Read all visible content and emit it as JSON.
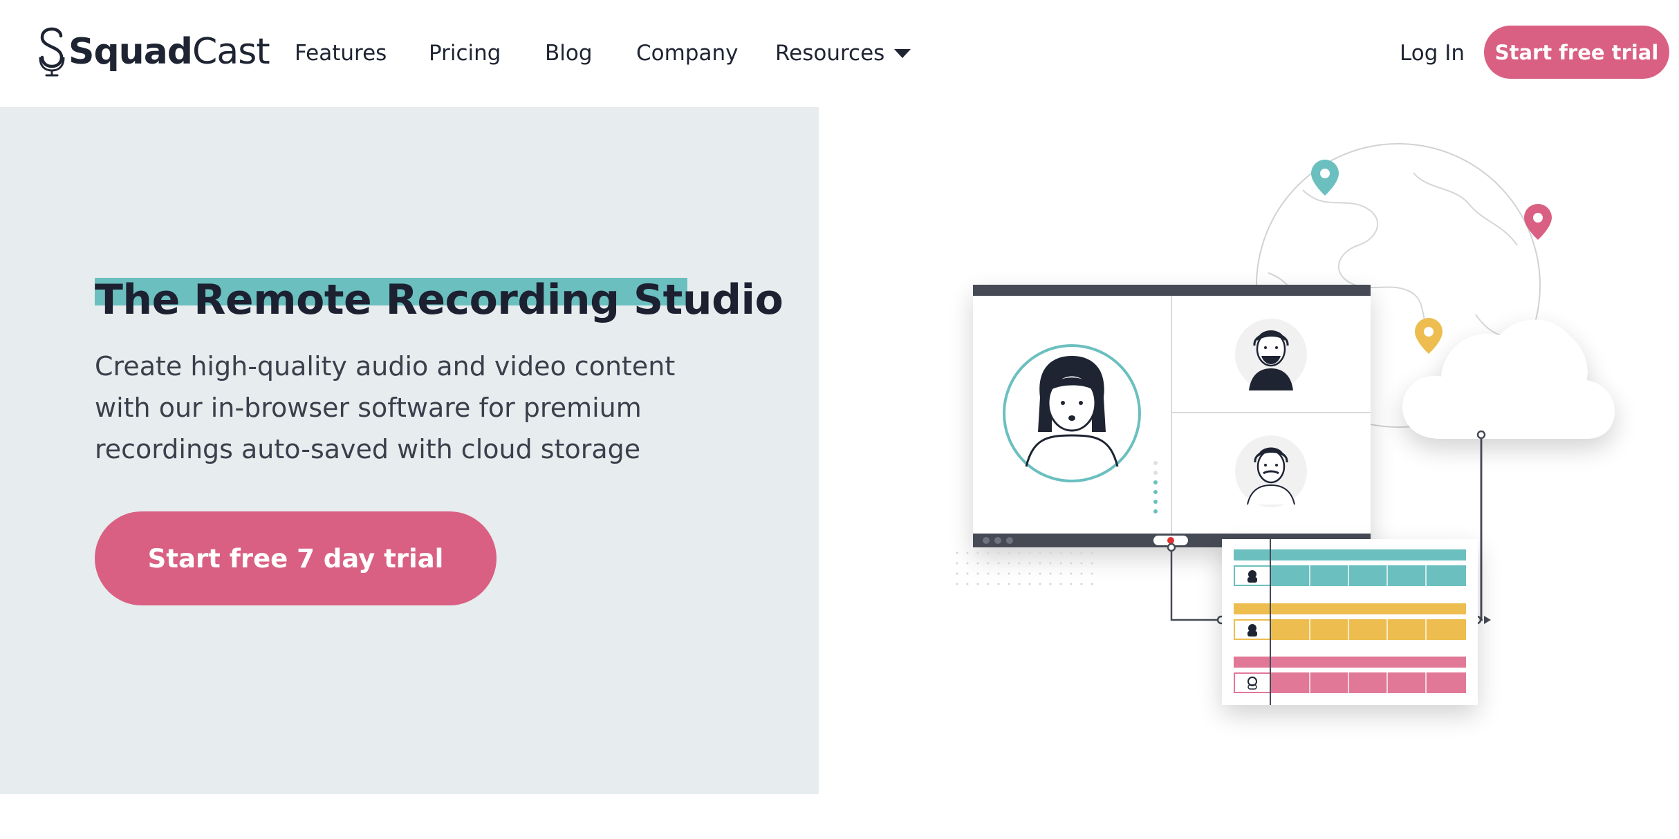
{
  "brand": {
    "name_bold": "Squad",
    "name_light": "Cast",
    "logo_icon": "microphone-s-logo-icon",
    "accent_pink": "#d96083",
    "accent_teal": "#6bbfbf",
    "accent_yellow": "#edbd4f",
    "text_dark": "#1f2433",
    "hero_bg": "#e7ecee"
  },
  "nav": {
    "links": [
      "Features",
      "Pricing",
      "Blog",
      "Company",
      "Resources"
    ],
    "resources_icon": "caret-down-icon",
    "login": "Log In",
    "cta": "Start free trial"
  },
  "hero": {
    "headline": "The Remote Recording Studio",
    "subtext": "Create high-quality audio and video content with our in-browser software for premium recordings auto-saved with cloud storage",
    "cta": "Start free 7 day trial"
  },
  "illustration": {
    "icons": [
      "globe-icon",
      "map-pin-icon",
      "cloud-icon",
      "video-call-window-icon",
      "recording-indicator-icon",
      "track-timeline-icon"
    ]
  }
}
